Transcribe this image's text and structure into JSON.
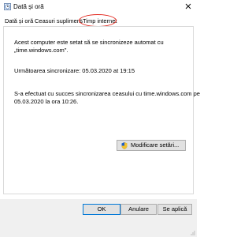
{
  "window": {
    "title": "Dată și oră"
  },
  "tabs": [
    {
      "label": "Dată și oră"
    },
    {
      "label": "Ceasuri suplimentare"
    },
    {
      "label": "Timp internet"
    }
  ],
  "content": {
    "line1": "Acest computer este setat să se sincronizeze automat cu",
    "line2": "„time.windows.com\".",
    "next_sync": "Următoarea sincronizare: 05.03.2020 at 19:15",
    "success1": "S-a efectuat cu succes sincronizarea ceasului cu time.windows.com pe",
    "success2": "05.03.2020 la ora 10:26."
  },
  "buttons": {
    "change_settings": "Modificare setări...",
    "ok": "OK",
    "cancel": "Anulare",
    "apply": "Se aplică"
  },
  "icons": {
    "window": "clock-icon",
    "close": "close-icon",
    "shield": "uac-shield-icon",
    "grip": "resize-grip-icon"
  },
  "colors": {
    "annotation_circle": "#e22218",
    "primary_border": "#0078d7"
  }
}
